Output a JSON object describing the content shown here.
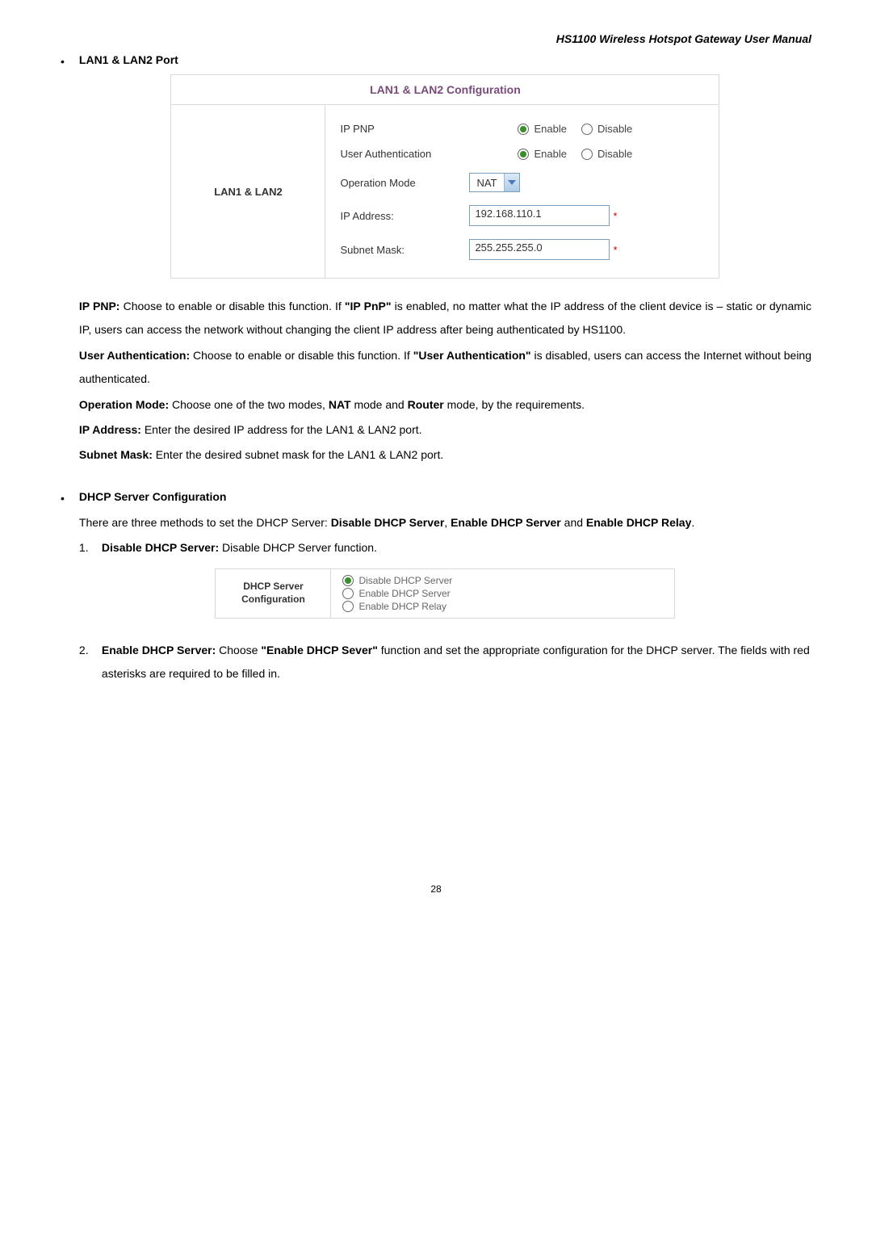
{
  "header": "HS1100 Wireless Hotspot Gateway User Manual",
  "sec1": {
    "heading": "LAN1 & LAN2 Port",
    "table_title": "LAN1 & LAN2 Configuration",
    "side_label": "LAN1 & LAN2",
    "rows": {
      "ippnp_label": "IP PNP",
      "userauth_label": "User Authentication",
      "opmode_label": "Operation Mode",
      "ipaddr_label": "IP Address:",
      "subnet_label": "Subnet Mask:",
      "enable": "Enable",
      "disable": "Disable",
      "opmode_value": "NAT",
      "ipaddr_value": "192.168.110.1",
      "subnet_value": "255.255.255.0"
    }
  },
  "desc": {
    "ippnp_b": "IP PNP:",
    "ippnp_t1": " Choose to enable or disable this function. If ",
    "ippnp_q": "\"IP PnP\"",
    "ippnp_t2": " is enabled, no matter what the IP address of the client device is – static or dynamic IP, users can access the network without changing the client IP address after being authenticated by HS1100.",
    "userauth_b": "User Authentication:",
    "userauth_t1": " Choose to enable or disable this function. If ",
    "userauth_q": "\"User Authentication\"",
    "userauth_t2": " is disabled, users can access the Internet without being authenticated.",
    "opmode_b": "Operation Mode:",
    "opmode_t1": " Choose one of the two modes, ",
    "opmode_nat": "NAT",
    "opmode_t2": " mode and ",
    "opmode_router": "Router",
    "opmode_t3": " mode, by the requirements.",
    "ipaddr_b": "IP Address:",
    "ipaddr_t": " Enter the desired IP address for the LAN1 & LAN2 port.",
    "subnet_b": "Subnet Mask:",
    "subnet_t": " Enter the desired subnet mask for the LAN1 & LAN2 port."
  },
  "sec2": {
    "heading": "DHCP Server Configuration",
    "intro_t1": "There are three methods to set the DHCP Server: ",
    "intro_b1": "Disable DHCP Server",
    "intro_sep1": ", ",
    "intro_b2": "Enable DHCP Server",
    "intro_sep2": " and ",
    "intro_b3": "Enable DHCP Relay",
    "intro_end": ".",
    "item1_num": "1.",
    "item1_b": "Disable DHCP Server:",
    "item1_t": " Disable DHCP Server function.",
    "dhcp_side1": "DHCP Server",
    "dhcp_side2": "Configuration",
    "dhcp_opt1": "Disable DHCP Server",
    "dhcp_opt2": "Enable DHCP Server",
    "dhcp_opt3": "Enable DHCP Relay",
    "item2_num": "2.",
    "item2_b": "Enable DHCP Server:",
    "item2_t1": " Choose ",
    "item2_q": "\"Enable DHCP Sever\"",
    "item2_t2": " function and set the appropriate configuration for the DHCP server. The fields with red asterisks are required to be filled in."
  },
  "page_num": "28"
}
